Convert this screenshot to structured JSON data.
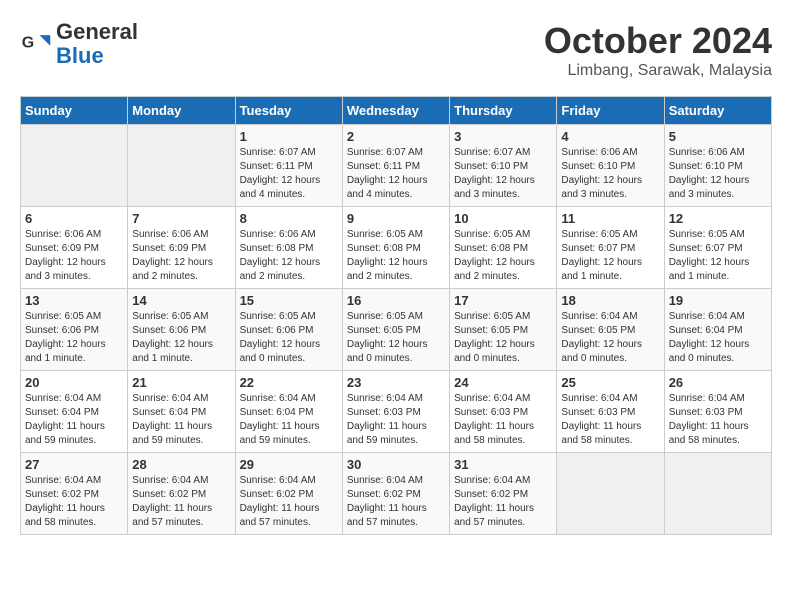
{
  "header": {
    "logo_line1": "General",
    "logo_line2": "Blue",
    "month": "October 2024",
    "location": "Limbang, Sarawak, Malaysia"
  },
  "weekdays": [
    "Sunday",
    "Monday",
    "Tuesday",
    "Wednesday",
    "Thursday",
    "Friday",
    "Saturday"
  ],
  "weeks": [
    [
      {
        "day": "",
        "info": ""
      },
      {
        "day": "",
        "info": ""
      },
      {
        "day": "1",
        "info": "Sunrise: 6:07 AM\nSunset: 6:11 PM\nDaylight: 12 hours\nand 4 minutes."
      },
      {
        "day": "2",
        "info": "Sunrise: 6:07 AM\nSunset: 6:11 PM\nDaylight: 12 hours\nand 4 minutes."
      },
      {
        "day": "3",
        "info": "Sunrise: 6:07 AM\nSunset: 6:10 PM\nDaylight: 12 hours\nand 3 minutes."
      },
      {
        "day": "4",
        "info": "Sunrise: 6:06 AM\nSunset: 6:10 PM\nDaylight: 12 hours\nand 3 minutes."
      },
      {
        "day": "5",
        "info": "Sunrise: 6:06 AM\nSunset: 6:10 PM\nDaylight: 12 hours\nand 3 minutes."
      }
    ],
    [
      {
        "day": "6",
        "info": "Sunrise: 6:06 AM\nSunset: 6:09 PM\nDaylight: 12 hours\nand 3 minutes."
      },
      {
        "day": "7",
        "info": "Sunrise: 6:06 AM\nSunset: 6:09 PM\nDaylight: 12 hours\nand 2 minutes."
      },
      {
        "day": "8",
        "info": "Sunrise: 6:06 AM\nSunset: 6:08 PM\nDaylight: 12 hours\nand 2 minutes."
      },
      {
        "day": "9",
        "info": "Sunrise: 6:05 AM\nSunset: 6:08 PM\nDaylight: 12 hours\nand 2 minutes."
      },
      {
        "day": "10",
        "info": "Sunrise: 6:05 AM\nSunset: 6:08 PM\nDaylight: 12 hours\nand 2 minutes."
      },
      {
        "day": "11",
        "info": "Sunrise: 6:05 AM\nSunset: 6:07 PM\nDaylight: 12 hours\nand 1 minute."
      },
      {
        "day": "12",
        "info": "Sunrise: 6:05 AM\nSunset: 6:07 PM\nDaylight: 12 hours\nand 1 minute."
      }
    ],
    [
      {
        "day": "13",
        "info": "Sunrise: 6:05 AM\nSunset: 6:06 PM\nDaylight: 12 hours\nand 1 minute."
      },
      {
        "day": "14",
        "info": "Sunrise: 6:05 AM\nSunset: 6:06 PM\nDaylight: 12 hours\nand 1 minute."
      },
      {
        "day": "15",
        "info": "Sunrise: 6:05 AM\nSunset: 6:06 PM\nDaylight: 12 hours\nand 0 minutes."
      },
      {
        "day": "16",
        "info": "Sunrise: 6:05 AM\nSunset: 6:05 PM\nDaylight: 12 hours\nand 0 minutes."
      },
      {
        "day": "17",
        "info": "Sunrise: 6:05 AM\nSunset: 6:05 PM\nDaylight: 12 hours\nand 0 minutes."
      },
      {
        "day": "18",
        "info": "Sunrise: 6:04 AM\nSunset: 6:05 PM\nDaylight: 12 hours\nand 0 minutes."
      },
      {
        "day": "19",
        "info": "Sunrise: 6:04 AM\nSunset: 6:04 PM\nDaylight: 12 hours\nand 0 minutes."
      }
    ],
    [
      {
        "day": "20",
        "info": "Sunrise: 6:04 AM\nSunset: 6:04 PM\nDaylight: 11 hours\nand 59 minutes."
      },
      {
        "day": "21",
        "info": "Sunrise: 6:04 AM\nSunset: 6:04 PM\nDaylight: 11 hours\nand 59 minutes."
      },
      {
        "day": "22",
        "info": "Sunrise: 6:04 AM\nSunset: 6:04 PM\nDaylight: 11 hours\nand 59 minutes."
      },
      {
        "day": "23",
        "info": "Sunrise: 6:04 AM\nSunset: 6:03 PM\nDaylight: 11 hours\nand 59 minutes."
      },
      {
        "day": "24",
        "info": "Sunrise: 6:04 AM\nSunset: 6:03 PM\nDaylight: 11 hours\nand 58 minutes."
      },
      {
        "day": "25",
        "info": "Sunrise: 6:04 AM\nSunset: 6:03 PM\nDaylight: 11 hours\nand 58 minutes."
      },
      {
        "day": "26",
        "info": "Sunrise: 6:04 AM\nSunset: 6:03 PM\nDaylight: 11 hours\nand 58 minutes."
      }
    ],
    [
      {
        "day": "27",
        "info": "Sunrise: 6:04 AM\nSunset: 6:02 PM\nDaylight: 11 hours\nand 58 minutes."
      },
      {
        "day": "28",
        "info": "Sunrise: 6:04 AM\nSunset: 6:02 PM\nDaylight: 11 hours\nand 57 minutes."
      },
      {
        "day": "29",
        "info": "Sunrise: 6:04 AM\nSunset: 6:02 PM\nDaylight: 11 hours\nand 57 minutes."
      },
      {
        "day": "30",
        "info": "Sunrise: 6:04 AM\nSunset: 6:02 PM\nDaylight: 11 hours\nand 57 minutes."
      },
      {
        "day": "31",
        "info": "Sunrise: 6:04 AM\nSunset: 6:02 PM\nDaylight: 11 hours\nand 57 minutes."
      },
      {
        "day": "",
        "info": ""
      },
      {
        "day": "",
        "info": ""
      }
    ]
  ]
}
